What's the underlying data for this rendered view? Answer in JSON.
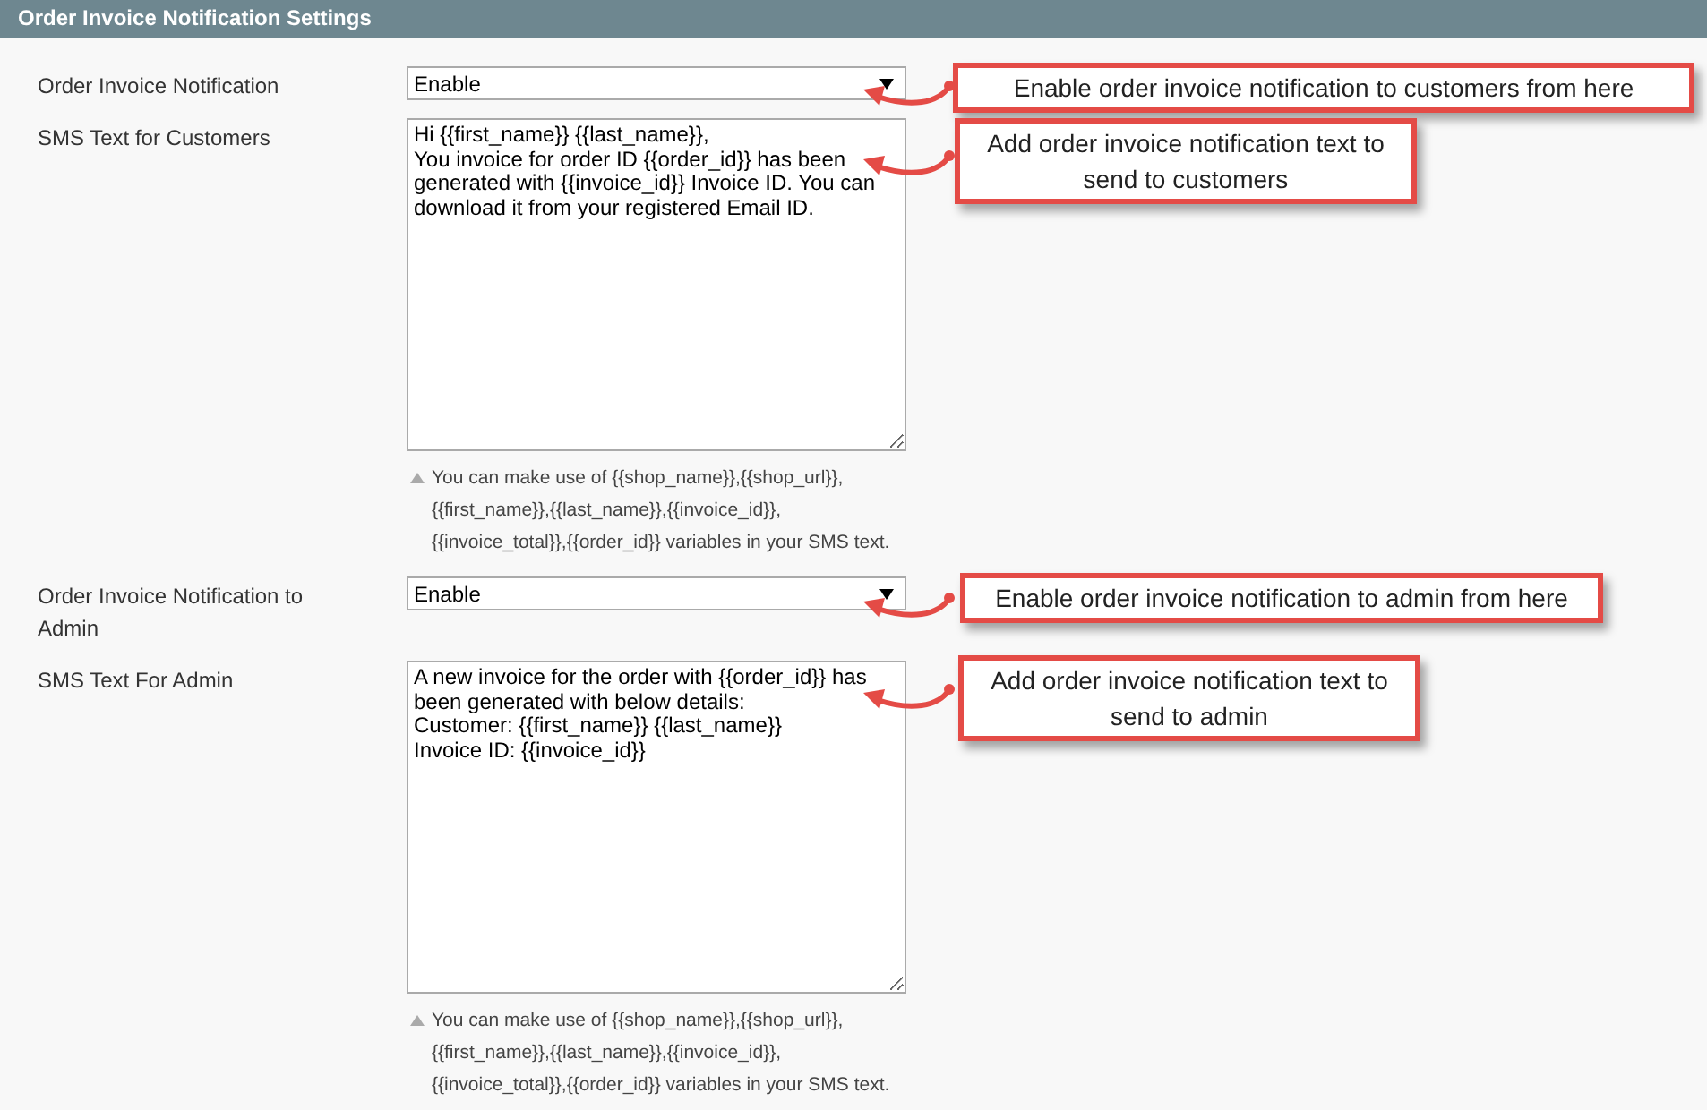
{
  "panel": {
    "title": "Order Invoice Notification Settings"
  },
  "fields": [
    {
      "kind": "select",
      "label": "Order Invoice Notification",
      "value": "Enable"
    },
    {
      "kind": "textarea",
      "label": "SMS Text for Customers",
      "value": "Hi {{first_name}} {{last_name}},\nYou invoice for order ID {{order_id}} has been generated with {{invoice_id}} Invoice ID. You can download it from your registered Email ID.",
      "hint": "You can make use of {{shop_name}},{{shop_url}}, {{first_name}},{{last_name}},{{invoice_id}}, {{invoice_total}},{{order_id}} variables in your SMS text."
    },
    {
      "kind": "select",
      "label": "Order Invoice Notification to Admin",
      "value": "Enable"
    },
    {
      "kind": "textarea",
      "label": "SMS Text For Admin",
      "value": "A new invoice for the order with {{order_id}} has been generated with below details:\nCustomer: {{first_name}} {{last_name}}\nInvoice ID: {{invoice_id}}",
      "hint": "You can make use of {{shop_name}},{{shop_url}}, {{first_name}},{{last_name}},{{invoice_id}}, {{invoice_total}},{{order_id}} variables in your SMS text."
    }
  ],
  "annotations": [
    {
      "text": "Enable order invoice notification to customers from here"
    },
    {
      "text": "Add order invoice notification text to send to customers"
    },
    {
      "text": "Enable order invoice notification to admin from here"
    },
    {
      "text": "Add order invoice notification text to send to admin"
    }
  ]
}
